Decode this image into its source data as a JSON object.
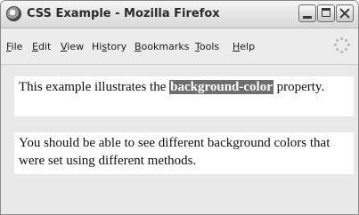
{
  "window": {
    "title": "CSS Example - Mozilla Firefox",
    "app_icon": "firefox-globe-icon",
    "controls": [
      "minimize-icon",
      "maximize-icon",
      "close-icon"
    ]
  },
  "menubar": {
    "items": [
      {
        "label": "File",
        "accel": "F",
        "rest": "ile"
      },
      {
        "label": "Edit",
        "accel": "E",
        "rest": "dit"
      },
      {
        "label": "View",
        "accel": "V",
        "rest": "iew"
      },
      {
        "label": "History",
        "pre": "Hi",
        "accel": "s",
        "rest": "tory"
      },
      {
        "label": "Bookmarks",
        "accel": "B",
        "rest": "ookmarks"
      },
      {
        "label": "Tools",
        "accel": "T",
        "rest": "ools"
      },
      {
        "label": "Help",
        "accel": "H",
        "rest": "elp"
      }
    ],
    "throbber_icon": "loading-throbber-icon"
  },
  "content": {
    "para1_before": "This example illustrates the ",
    "para1_highlight": "background-color",
    "para1_after": " property.",
    "para2": "You should be able to see different background colors that were set using different methods."
  },
  "colors": {
    "highlight_bg": "#6e6e6e",
    "page_bg": "#e9e9e9",
    "para_bg": "#ffffff"
  }
}
